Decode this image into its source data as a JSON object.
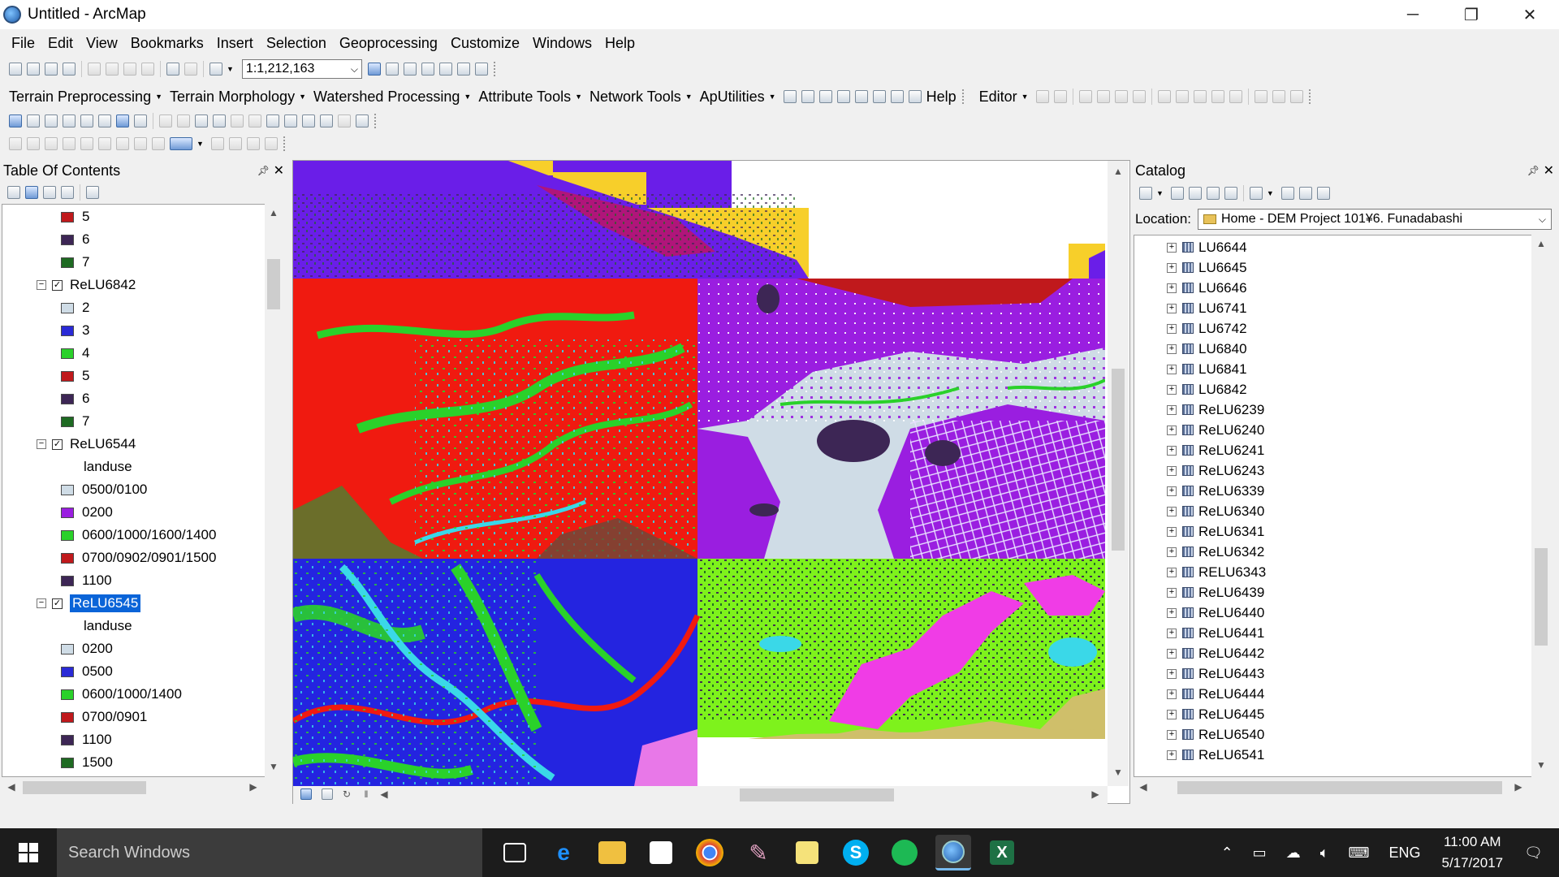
{
  "window": {
    "title": "Untitled - ArcMap",
    "minimize": "─",
    "maximize": "❐",
    "close": "✕"
  },
  "menu": [
    "File",
    "Edit",
    "View",
    "Bookmarks",
    "Insert",
    "Selection",
    "Geoprocessing",
    "Customize",
    "Windows",
    "Help"
  ],
  "standard_toolbar": {
    "scale": "1:1,212,163"
  },
  "arc_toolbar": {
    "items": [
      "Terrain Preprocessing",
      "Terrain Morphology",
      "Watershed Processing",
      "Attribute Tools",
      "Network Tools",
      "ApUtilities"
    ],
    "help": "Help",
    "editor": "Editor"
  },
  "toc": {
    "title": "Table Of Contents",
    "rows": [
      {
        "type": "class",
        "label": "5",
        "color": "#c0191c"
      },
      {
        "type": "class",
        "label": "6",
        "color": "#3d2655"
      },
      {
        "type": "class",
        "label": "7",
        "color": "#1e6a22"
      },
      {
        "type": "layer",
        "label": "ReLU6842",
        "checked": true
      },
      {
        "type": "class",
        "label": "2",
        "color": "#cfdce6"
      },
      {
        "type": "class",
        "label": "3",
        "color": "#2a2ad6"
      },
      {
        "type": "class",
        "label": "4",
        "color": "#2ad12a"
      },
      {
        "type": "class",
        "label": "5",
        "color": "#c0191c"
      },
      {
        "type": "class",
        "label": "6",
        "color": "#3d2655"
      },
      {
        "type": "class",
        "label": "7",
        "color": "#1e6a22"
      },
      {
        "type": "layer",
        "label": "ReLU6544",
        "checked": true
      },
      {
        "type": "field",
        "label": "landuse"
      },
      {
        "type": "class",
        "label": "0500/0100",
        "color": "#cfdce6"
      },
      {
        "type": "class",
        "label": "0200",
        "color": "#9a1ee0"
      },
      {
        "type": "class",
        "label": "0600/1000/1600/1400",
        "color": "#2ad12a"
      },
      {
        "type": "class",
        "label": "0700/0902/0901/1500",
        "color": "#c0191c"
      },
      {
        "type": "class",
        "label": "1100",
        "color": "#3d2655"
      },
      {
        "type": "layer",
        "label": "ReLU6545",
        "checked": true,
        "selected": true
      },
      {
        "type": "field",
        "label": "landuse"
      },
      {
        "type": "class",
        "label": "0200",
        "color": "#cfdce6"
      },
      {
        "type": "class",
        "label": "0500",
        "color": "#2a2ad6"
      },
      {
        "type": "class",
        "label": "0600/1000/1400",
        "color": "#2ad12a"
      },
      {
        "type": "class",
        "label": "0700/0901",
        "color": "#c0191c"
      },
      {
        "type": "class",
        "label": "1100",
        "color": "#3d2655"
      },
      {
        "type": "class",
        "label": "1500",
        "color": "#1e6a22"
      }
    ]
  },
  "catalog": {
    "title": "Catalog",
    "location_label": "Location:",
    "location_value": "Home - DEM Project 101¥6. Funadabashi",
    "items": [
      "LU6644",
      "LU6645",
      "LU6646",
      "LU6741",
      "LU6742",
      "LU6840",
      "LU6841",
      "LU6842",
      "ReLU6239",
      "ReLU6240",
      "ReLU6241",
      "ReLU6243",
      "ReLU6339",
      "ReLU6340",
      "ReLU6341",
      "ReLU6342",
      "RELU6343",
      "ReLU6439",
      "ReLU6440",
      "ReLU6441",
      "ReLU6442",
      "ReLU6443",
      "ReLU6444",
      "ReLU6445",
      "ReLU6540",
      "ReLU6541"
    ]
  },
  "taskbar": {
    "search_placeholder": "Search Windows",
    "language": "ENG",
    "time": "11:00 AM",
    "date": "5/17/2017"
  },
  "colors": {
    "red": "#f01a10",
    "purple": "#6a1ee8",
    "blue": "#2424e0",
    "lime": "#7ef21c",
    "lightgray": "#cfdce6",
    "yellow": "#f7cf2a",
    "magenta": "#f03ce6",
    "tan": "#cfbf6a",
    "darkred": "#c0191c",
    "violet": "#9a1ee0",
    "green": "#2ad12a",
    "dark": "#3d2655",
    "pink": "#e878e8",
    "cyan": "#3ad8e8"
  }
}
